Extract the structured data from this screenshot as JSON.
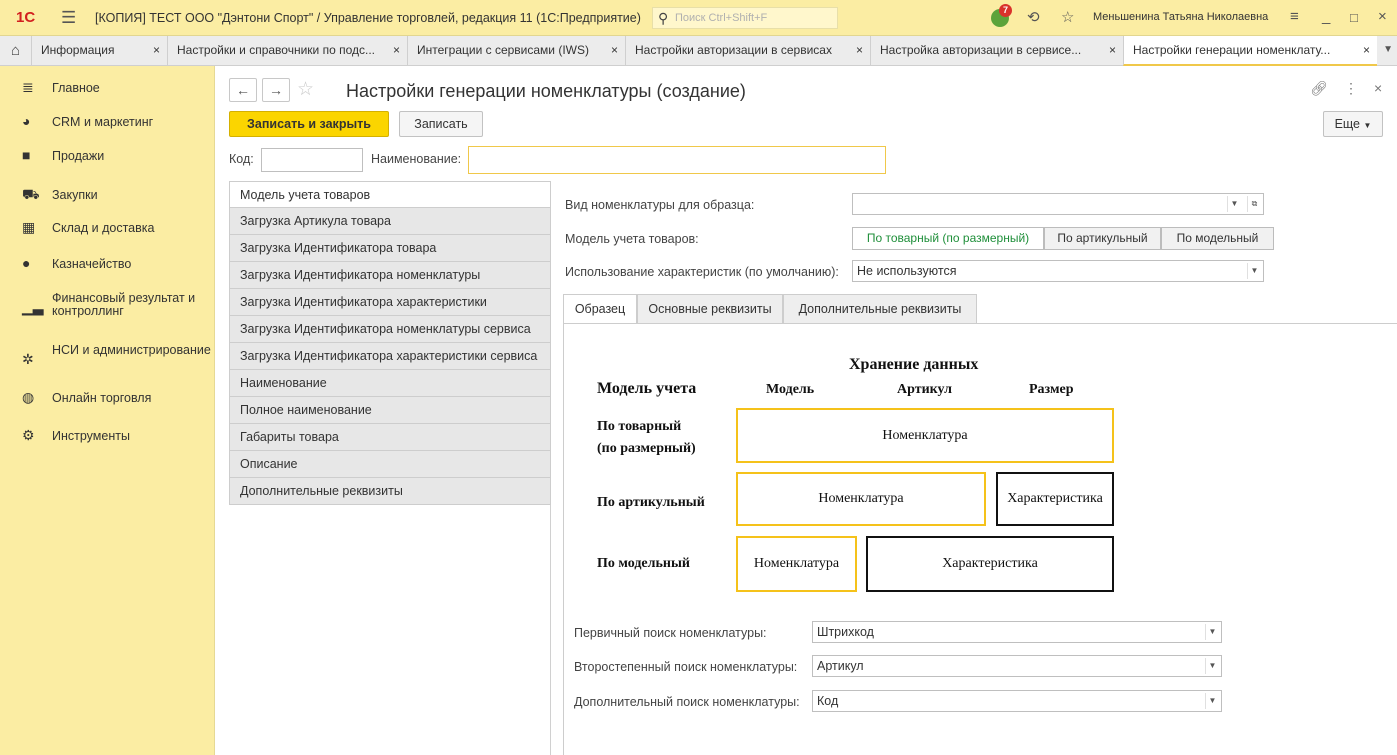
{
  "window": {
    "logo": "1С",
    "title": "[КОПИЯ] ТЕСТ ООО \"Дэнтони Спорт\" / Управление торговлей, редакция 11  (1С:Предприятие)",
    "search_placeholder": "Поиск Ctrl+Shift+F",
    "notification_count": "7",
    "user": "Меньшенина Татьяна Николаевна"
  },
  "tabs": [
    {
      "label": "Информация",
      "close": "×"
    },
    {
      "label": "Настройки и справочники по подс...",
      "close": "×"
    },
    {
      "label": "Интеграции с сервисами (IWS)",
      "close": "×"
    },
    {
      "label": "Настройки авторизации в сервисах",
      "close": "×"
    },
    {
      "label": "Настройка авторизации в сервисе...",
      "close": "×"
    },
    {
      "label": "Настройки генерации номенклату...",
      "close": "×"
    }
  ],
  "sidebar": {
    "items": [
      {
        "label": "Главное",
        "icon": "menu-icon"
      },
      {
        "label": "CRM и маркетинг",
        "icon": "pie-chart-icon"
      },
      {
        "label": "Продажи",
        "icon": "bag-icon"
      },
      {
        "label": "Закупки",
        "icon": "cart-icon"
      },
      {
        "label": "Склад и доставка",
        "icon": "warehouse-icon"
      },
      {
        "label": "Казначейство",
        "icon": "ruble-icon"
      },
      {
        "label": "Финансовый результат и контроллинг",
        "icon": "bar-chart-icon"
      },
      {
        "label": "НСИ и администрирование",
        "icon": "gear-icon"
      },
      {
        "label": "Онлайн торговля",
        "icon": "globe-icon"
      },
      {
        "label": "Инструменты",
        "icon": "tools-icon"
      }
    ]
  },
  "form": {
    "title": "Настройки генерации номенклатуры (создание)",
    "save_close": "Записать и закрыть",
    "save": "Записать",
    "more": "Еще",
    "code_label": "Код:",
    "code_value": "",
    "name_label": "Наименование:",
    "name_value": ""
  },
  "left_list": [
    "Модель учета товаров",
    "Загрузка Артикула товара",
    "Загрузка Идентификатора товара",
    "Загрузка Идентификатора номенклатуры",
    "Загрузка Идентификатора характеристики",
    "Загрузка Идентификатора номенклатуры сервиса",
    "Загрузка Идентификатора характеристики сервиса",
    "Наименование",
    "Полное наименование",
    "Габариты товара",
    "Описание",
    "Дополнительные реквизиты"
  ],
  "right": {
    "kind_label": "Вид номенклатуры для образца:",
    "kind_value": "",
    "model_label": "Модель учета товаров:",
    "model_options": [
      "По товарный (по размерный)",
      "По артикульный",
      "По модельный"
    ],
    "model_selected": "По товарный (по размерный)",
    "char_label": "Использование характеристик (по умолчанию):",
    "char_value": "Не используются",
    "panel_tabs": [
      "Образец",
      "Основные реквизиты",
      "Дополнительные реквизиты"
    ],
    "active_panel_tab": "Образец"
  },
  "diagram": {
    "storage_title": "Хранение данных",
    "model_header": "Модель учета",
    "col_model": "Модель",
    "col_article": "Артикул",
    "col_size": "Размер",
    "row1_label_a": "По товарный",
    "row1_label_b": "(по размерный)",
    "row2_label": "По артикульный",
    "row3_label": "По модельный",
    "nomenclature": "Номенклатура",
    "characteristic": "Характеристика"
  },
  "search": {
    "primary_label": "Первичный поиск номенклатуры:",
    "primary_value": "Штрихкод",
    "secondary_label": "Второстепенный поиск номенклатуры:",
    "secondary_value": "Артикул",
    "additional_label": "Дополнительный поиск номенклатуры:",
    "additional_value": "Код"
  }
}
